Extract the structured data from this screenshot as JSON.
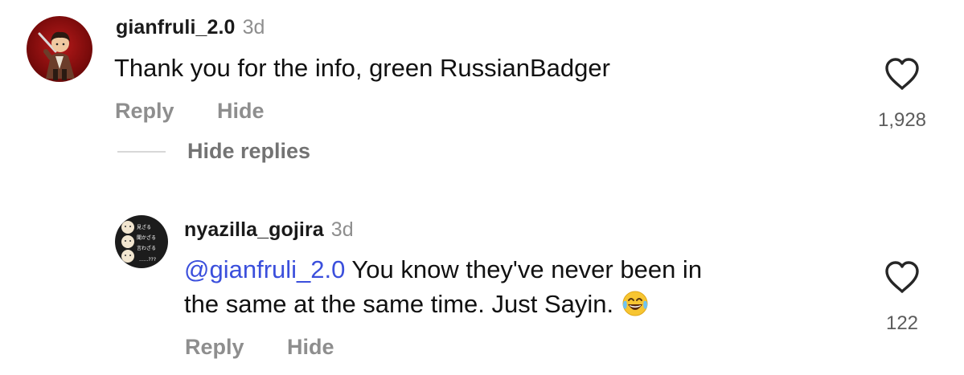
{
  "comments": [
    {
      "username": "gianfruli_2.0",
      "timestamp": "3d",
      "text": "Thank you for the info, green RussianBadger",
      "actions": {
        "reply": "Reply",
        "hide": "Hide"
      },
      "like_count": "1,928",
      "avatar_icon": "cartoon-man-avatar-icon"
    },
    {
      "username": "nyazilla_gojira",
      "timestamp": "3d",
      "mention": "@gianfruli_2.0",
      "text_line1": " You know they've never been in",
      "text_line2": "the same at the same time. Just Sayin.",
      "emoji_icon": "face-with-tears-of-joy-icon",
      "actions": {
        "reply": "Reply",
        "hide": "Hide"
      },
      "like_count": "122",
      "avatar_icon": "three-monkeys-avatar-icon",
      "avatar_labels": [
        "見ざる",
        "聞かざる",
        "言わざる",
        "......???"
      ]
    }
  ],
  "thread": {
    "hide_replies_label": "Hide replies"
  },
  "colors": {
    "mention": "#3b4fdc",
    "muted": "#8e8e8e",
    "avatar_red": "#9b1212"
  }
}
